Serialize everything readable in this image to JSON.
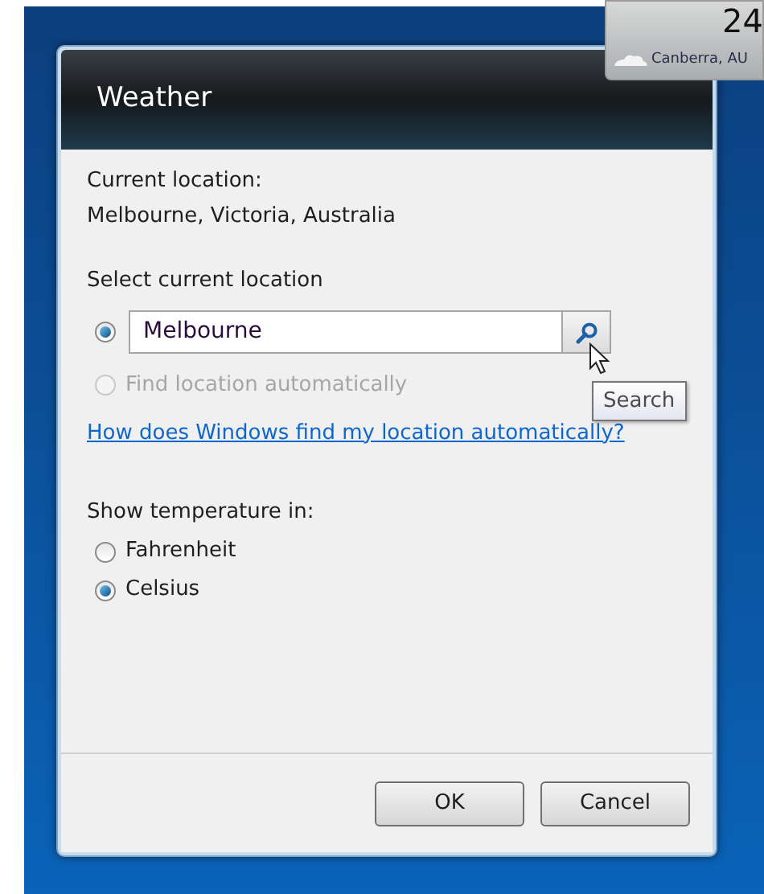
{
  "gadget": {
    "temperature": "24",
    "location": "Canberra, AU"
  },
  "dialog": {
    "title": "Weather",
    "current_location_label": "Current location:",
    "current_location": "Melbourne, Victoria, Australia",
    "select_heading": "Select current location",
    "location_options": [
      {
        "kind": "search",
        "value": "Melbourne",
        "selected": true,
        "disabled": false
      },
      {
        "kind": "auto",
        "label": "Find location automatically",
        "selected": false,
        "disabled": true
      }
    ],
    "search_tooltip": "Search",
    "help_link": "How does Windows find my location automatically?",
    "temperature_heading": "Show temperature in:",
    "units": [
      {
        "label": "Fahrenheit",
        "selected": false
      },
      {
        "label": "Celsius",
        "selected": true
      }
    ],
    "buttons": [
      "OK",
      "Cancel"
    ]
  }
}
